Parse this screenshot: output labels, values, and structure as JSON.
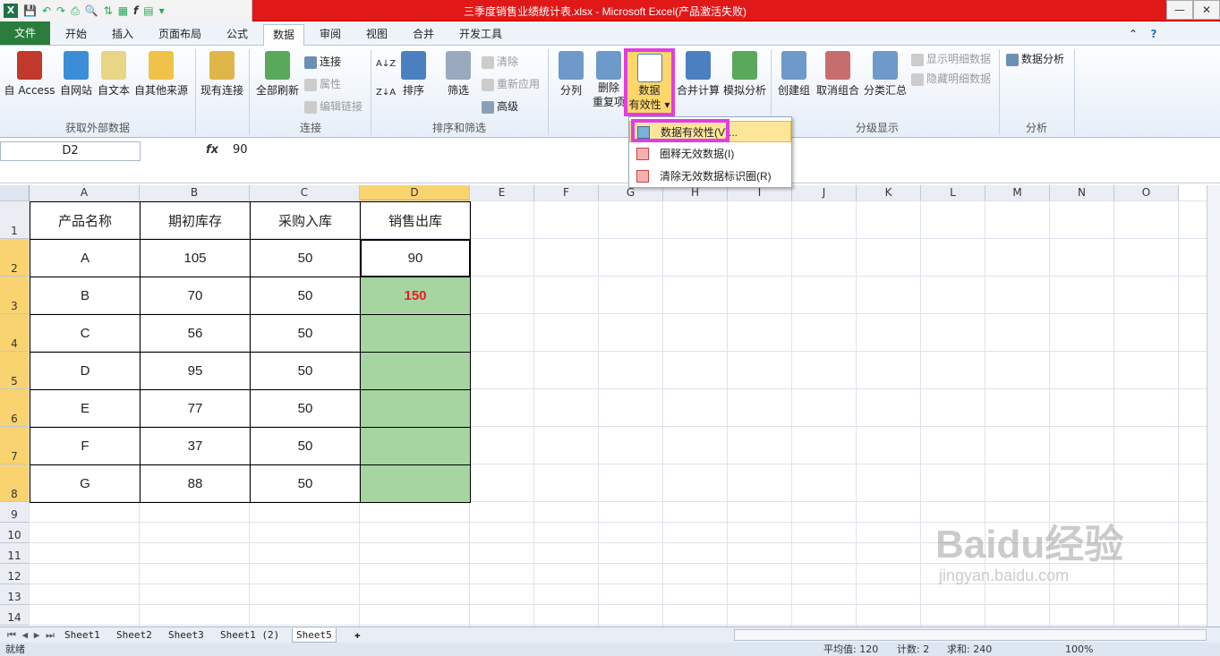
{
  "window": {
    "title": "三季度销售业绩统计表.xlsx - Microsoft Excel(产品激活失败)",
    "app_icon": "X"
  },
  "tabs": [
    "文件",
    "开始",
    "插入",
    "页面布局",
    "公式",
    "数据",
    "审阅",
    "视图",
    "合并",
    "开发工具"
  ],
  "ribbon": {
    "get_external": {
      "label": "获取外部数据",
      "items": [
        "自 Access",
        "自网站",
        "自文本",
        "自其他来源"
      ]
    },
    "existing_conn": "现有连接",
    "connections": {
      "label": "连接",
      "refresh": "全部刷新",
      "conn": "连接",
      "props": "属性",
      "edit_links": "编辑链接"
    },
    "sort_filter": {
      "label": "排序和筛选",
      "sort": "排序",
      "filter": "筛选",
      "clear": "清除",
      "reapply": "重新应用",
      "advanced": "高级",
      "az": "A↓Z",
      "za": "Z↓A"
    },
    "data_tools": {
      "split": "分列",
      "remove_dup_1": "删除",
      "remove_dup_2": "重复项",
      "validation_1": "数据",
      "validation_2": "有效性",
      "consolidate": "合并计算",
      "whatif": "模拟分析"
    },
    "outline": {
      "label": "分级显示",
      "group": "创建组",
      "ungroup": "取消组合",
      "subtotal": "分类汇总",
      "show_detail": "显示明细数据",
      "hide_detail": "隐藏明细数据"
    },
    "analysis": {
      "label": "分析",
      "data_analysis": "数据分析"
    }
  },
  "formula_bar": {
    "name_box": "D2",
    "fx": "fx",
    "value": "90"
  },
  "dropdown": [
    "数据有效性(V)...",
    "圈释无效数据(I)",
    "清除无效数据标识圈(R)"
  ],
  "columns": [
    "A",
    "B",
    "C",
    "D",
    "E",
    "F",
    "G",
    "H",
    "I",
    "J",
    "K",
    "L",
    "M",
    "N",
    "O"
  ],
  "rows": [
    "1",
    "2",
    "3",
    "4",
    "5",
    "6",
    "7",
    "8",
    "9",
    "10",
    "11",
    "12",
    "13",
    "14"
  ],
  "table": {
    "headers": [
      "产品名称",
      "期初库存",
      "采购入库",
      "销售出库"
    ],
    "rows": [
      [
        "A",
        "105",
        "50",
        "90"
      ],
      [
        "B",
        "70",
        "50",
        "150"
      ],
      [
        "C",
        "56",
        "50",
        ""
      ],
      [
        "D",
        "95",
        "50",
        ""
      ],
      [
        "E",
        "77",
        "50",
        ""
      ],
      [
        "F",
        "37",
        "50",
        ""
      ],
      [
        "G",
        "88",
        "50",
        ""
      ]
    ]
  },
  "sheets": [
    "Sheet1",
    "Sheet2",
    "Sheet3",
    "Sheet1 (2)",
    "Sheet5"
  ],
  "status": {
    "ready": "就绪",
    "average": "平均值: 120",
    "count": "计数: 2",
    "sum": "求和: 240",
    "zoom": "100%"
  },
  "watermark": {
    "line1": "Baidu经验",
    "line2": "jingyan.baidu.com"
  },
  "colors": {
    "title_red": "#e11818",
    "file_green": "#2a7d3c",
    "highlight": "#e23de0",
    "fill_green": "#a6d5a1",
    "invalid_red": "#e02020"
  }
}
